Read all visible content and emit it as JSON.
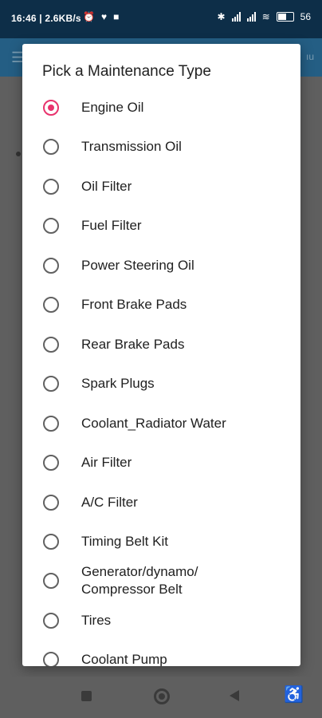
{
  "status_bar": {
    "time_speed": "16:46 | 2.6KB/s",
    "battery": "56"
  },
  "app_bar": {
    "right_text": "ıu"
  },
  "dialog": {
    "title": "Pick a Maintenance Type",
    "options": [
      {
        "label": "Engine Oil",
        "checked": true
      },
      {
        "label": "Transmission Oil",
        "checked": false
      },
      {
        "label": "Oil Filter",
        "checked": false
      },
      {
        "label": "Fuel Filter",
        "checked": false
      },
      {
        "label": "Power Steering Oil",
        "checked": false
      },
      {
        "label": "Front Brake Pads",
        "checked": false
      },
      {
        "label": "Rear Brake Pads",
        "checked": false
      },
      {
        "label": "Spark Plugs",
        "checked": false
      },
      {
        "label": "Coolant_Radiator Water",
        "checked": false
      },
      {
        "label": "Air Filter",
        "checked": false
      },
      {
        "label": "A/C Filter",
        "checked": false
      },
      {
        "label": "Timing Belt Kit",
        "checked": false
      },
      {
        "label": "Generator/dynamo/ Compressor Belt",
        "checked": false
      },
      {
        "label": "Tires",
        "checked": false
      },
      {
        "label": "Coolant Pump",
        "checked": false
      }
    ]
  },
  "accent_color": "#e8336d"
}
